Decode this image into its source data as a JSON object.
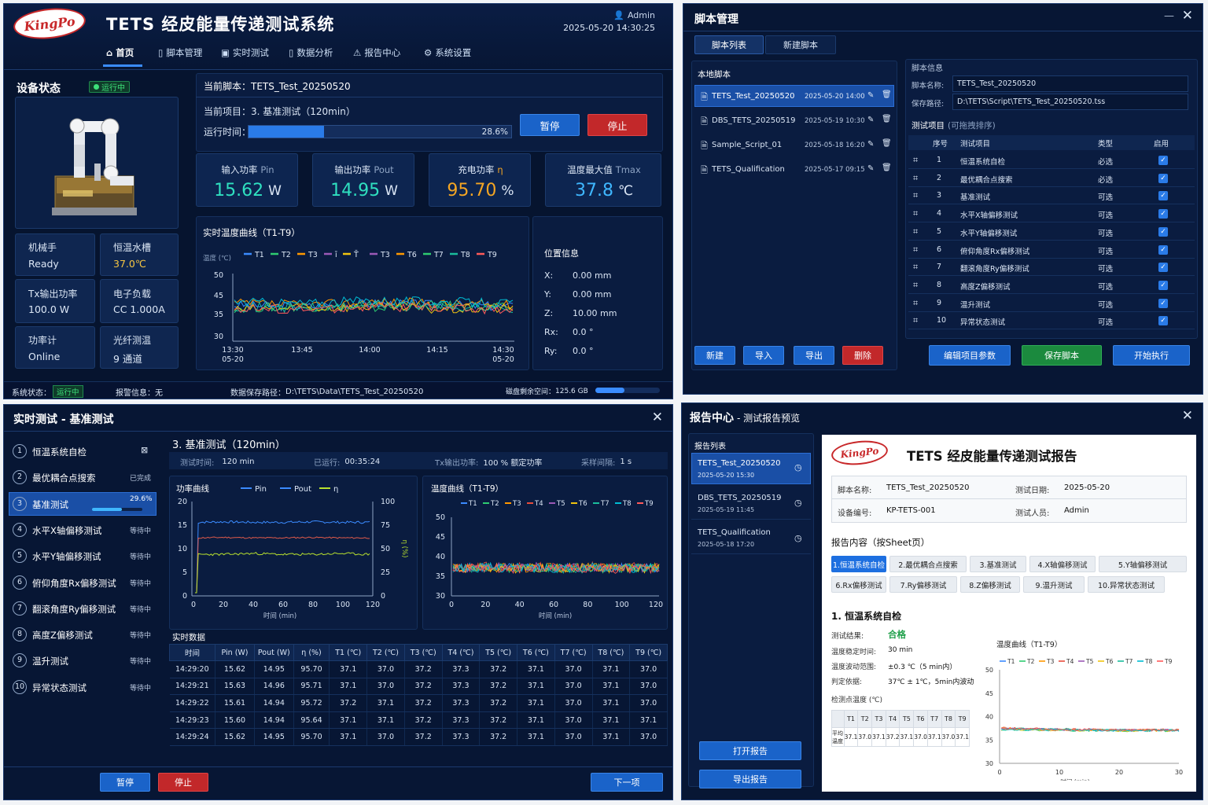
{
  "main": {
    "logo": "KingPo",
    "app_title": "TETS 经皮能量传递测试系统",
    "user": "Admin",
    "datetime": "2025-05-20 14:30:25",
    "nav": [
      {
        "label": "首页",
        "icon": "home-icon"
      },
      {
        "label": "脚本管理",
        "icon": "script-icon"
      },
      {
        "label": "实时测试",
        "icon": "monitor-icon"
      },
      {
        "label": "数据分析",
        "icon": "analysis-icon"
      },
      {
        "label": "报告中心",
        "icon": "report-icon"
      },
      {
        "label": "系统设置",
        "icon": "gear-icon"
      }
    ],
    "device_status_title": "设备状态",
    "device_running_badge": "运行中",
    "device_cells": [
      {
        "label": "机械手",
        "value": "Ready"
      },
      {
        "label": "恒温水槽",
        "value": "37.0℃"
      },
      {
        "label": "Tx输出功率",
        "value": "100.0 W"
      },
      {
        "label": "电子负载",
        "value": "CC 1.000A"
      },
      {
        "label": "功率计",
        "value": "Online"
      },
      {
        "label": "光纤测温",
        "value": "9 通道"
      }
    ],
    "current_script_label": "当前脚本：",
    "current_script": "TETS_Test_20250520",
    "current_item_label": "当前项目：",
    "current_item": "3. 基准测试（120min）",
    "run_time_label": "运行时间：",
    "progress_pct": "28.6%",
    "progress_value": 0.286,
    "pause_label": "暂停",
    "stop_label": "停止",
    "metrics": [
      {
        "label": "输入功率",
        "sym": "Pin",
        "value": "15.62",
        "unit": "W",
        "color": "#2fe0c0"
      },
      {
        "label": "输出功率",
        "sym": "Pout",
        "value": "14.95",
        "unit": "W",
        "color": "#2fe0c0"
      },
      {
        "label": "充电功率",
        "sym": "η",
        "value": "95.70",
        "unit": "%",
        "color": "#f5a623"
      },
      {
        "label": "温度最大值",
        "sym": "Tmax",
        "value": "37.8",
        "unit": "℃",
        "color": "#3fb7ff"
      }
    ],
    "temp_chart_title": "实时温度曲线（T1-T9）",
    "temp_unit": "温度 (℃)",
    "temp_legend": [
      "T1",
      "T2",
      "T3",
      "T4",
      "T5",
      "T6",
      "T7",
      "T8",
      "T9"
    ],
    "temp_legend_shown": [
      "T1",
      "T2",
      "T3",
      "ī",
      "T̄",
      "T3",
      "T6",
      "T7",
      "T8",
      "T9"
    ],
    "temp_y_ticks": [
      "50",
      "45",
      "35",
      "30"
    ],
    "temp_x_ticks": [
      [
        "13:30",
        "05-20"
      ],
      [
        "13:45",
        ""
      ],
      [
        "14:00",
        ""
      ],
      [
        "14:15",
        ""
      ],
      [
        "14:30",
        "05-20"
      ]
    ],
    "pos_title": "位置信息",
    "pos": [
      {
        "k": "X:",
        "v": "0.00 mm"
      },
      {
        "k": "Y:",
        "v": "0.00 mm"
      },
      {
        "k": "Z:",
        "v": "10.00 mm"
      },
      {
        "k": "Rx:",
        "v": "0.0 °"
      },
      {
        "k": "Ry:",
        "v": "0.0 °"
      }
    ],
    "status_bar": {
      "sys_label": "系统状态：",
      "sys_value": "运行中",
      "alarm_label": "报警信息：",
      "alarm_value": "无",
      "path_label": "数据保存路径：",
      "path_value": "D:\\TETS\\Data\\TETS_Test_20250520",
      "disk_label": "磁盘剩余空间：",
      "disk_value": "125.6 GB",
      "disk_fill": 0.45
    }
  },
  "script_mgr": {
    "title": "脚本管理",
    "tabs": [
      "脚本列表",
      "新建脚本"
    ],
    "local_title": "本地脚本",
    "scripts": [
      {
        "name": "TETS_Test_20250520",
        "date": "2025-05-20 14:00",
        "active": true
      },
      {
        "name": "DBS_TETS_20250519",
        "date": "2025-05-19 10:30",
        "active": false
      },
      {
        "name": "Sample_Script_01",
        "date": "2025-05-18 16:20",
        "active": false
      },
      {
        "name": "TETS_Qualification",
        "date": "2025-05-17 09:15",
        "active": false
      }
    ],
    "info_title": "脚本信息",
    "name_label": "脚本名称:",
    "name_value": "TETS_Test_20250520",
    "path_label": "保存路径:",
    "path_value": "D:\\TETS\\Script\\TETS_Test_20250520.tss",
    "items_title": "测试项目",
    "items_hint": "(可拖拽排序)",
    "cols": [
      "序号",
      "测试项目",
      "类型",
      "启用"
    ],
    "items": [
      {
        "no": "1",
        "name": "恒温系统自检",
        "type": "必选"
      },
      {
        "no": "2",
        "name": "最优耦合点搜索",
        "type": "必选"
      },
      {
        "no": "3",
        "name": "基准测试",
        "type": "可选"
      },
      {
        "no": "4",
        "name": "水平X轴偏移测试",
        "type": "可选"
      },
      {
        "no": "5",
        "name": "水平Y轴偏移测试",
        "type": "可选"
      },
      {
        "no": "6",
        "name": "俯仰角度Rx偏移测试",
        "type": "可选"
      },
      {
        "no": "7",
        "name": "翻滚角度Ry偏移测试",
        "type": "可选"
      },
      {
        "no": "8",
        "name": "高度Z偏移测试",
        "type": "可选"
      },
      {
        "no": "9",
        "name": "温升测试",
        "type": "可选"
      },
      {
        "no": "10",
        "name": "异常状态测试",
        "type": "可选"
      }
    ],
    "left_buttons": [
      "新建",
      "导入",
      "导出",
      "删除"
    ],
    "right_buttons": [
      "编辑项目参数",
      "保存脚本",
      "开始执行"
    ]
  },
  "realtime": {
    "title": "实时测试 - 基准测试",
    "steps": [
      {
        "no": "1",
        "label": "恒温系统自检",
        "status": ""
      },
      {
        "no": "2",
        "label": "最优耦合点搜索",
        "status": "已完成"
      },
      {
        "no": "3",
        "label": "基准测试",
        "status": "29.6%"
      },
      {
        "no": "4",
        "label": "水平X轴偏移测试",
        "status": "等待中"
      },
      {
        "no": "5",
        "label": "水平Y轴偏移测试",
        "status": "等待中"
      },
      {
        "no": "6",
        "label": "俯仰角度Rx偏移测试",
        "status": "等待中"
      },
      {
        "no": "7",
        "label": "翻滚角度Ry偏移测试",
        "status": "等待中"
      },
      {
        "no": "8",
        "label": "高度Z偏移测试",
        "status": "等待中"
      },
      {
        "no": "9",
        "label": "温升测试",
        "status": "等待中"
      },
      {
        "no": "10",
        "label": "异常状态测试",
        "status": "等待中"
      }
    ],
    "step3_progress": 0.296,
    "header": "3. 基准测试（120min）",
    "meta": [
      {
        "k": "测试时间:",
        "v": "120  min"
      },
      {
        "k": "已运行:",
        "v": "00:35:24"
      },
      {
        "k": "Tx输出功率:",
        "v": "100  % 额定功率"
      },
      {
        "k": "采样间隔:",
        "v": "1  s"
      }
    ],
    "power_chart": {
      "title": "功率曲线",
      "legend": [
        "Pin",
        "Pout",
        "η"
      ],
      "y_left": [
        "20",
        "15",
        "10",
        "5",
        "0"
      ],
      "y_right": [
        "100",
        "75",
        "50",
        "25",
        "0"
      ],
      "y_right_label": "η (%)",
      "x_ticks": [
        "0",
        "20",
        "40",
        "60",
        "80",
        "100",
        "120"
      ],
      "x_label": "时间 (min)"
    },
    "temp_chart": {
      "title": "温度曲线（T1-T9）",
      "legend": [
        "T1",
        "T2",
        "T3",
        "T4",
        "T5",
        "T6",
        "T7",
        "T8",
        "T9"
      ],
      "y_ticks": [
        "50",
        "45",
        "40",
        "35",
        "30"
      ],
      "x_ticks": [
        "0",
        "20",
        "40",
        "60",
        "80",
        "100",
        "120"
      ],
      "x_label": "时间 (min)"
    },
    "table_title": "实时数据",
    "table_cols": [
      "时间",
      "Pin (W)",
      "Pout (W)",
      "η (%)",
      "T1 (℃)",
      "T2 (℃)",
      "T3 (℃)",
      "T4 (℃)",
      "T5 (℃)",
      "T6 (℃)",
      "T7 (℃)",
      "T8 (℃)",
      "T9 (℃)"
    ],
    "table_rows": [
      [
        "14:29:20",
        "15.62",
        "14.95",
        "95.70",
        "37.1",
        "37.0",
        "37.2",
        "37.3",
        "37.2",
        "37.1",
        "37.0",
        "37.1",
        "37.0"
      ],
      [
        "14:29:21",
        "15.63",
        "14.96",
        "95.71",
        "37.1",
        "37.0",
        "37.2",
        "37.3",
        "37.2",
        "37.1",
        "37.0",
        "37.1",
        "37.0"
      ],
      [
        "14:29:22",
        "15.61",
        "14.94",
        "95.72",
        "37.2",
        "37.1",
        "37.2",
        "37.3",
        "37.2",
        "37.1",
        "37.0",
        "37.1",
        "37.0"
      ],
      [
        "14:29:23",
        "15.60",
        "14.94",
        "95.64",
        "37.1",
        "37.1",
        "37.2",
        "37.3",
        "37.2",
        "37.1",
        "37.0",
        "37.1",
        "37.1"
      ],
      [
        "14:29:24",
        "15.62",
        "14.95",
        "95.70",
        "37.1",
        "37.0",
        "37.2",
        "37.3",
        "37.2",
        "37.1",
        "37.0",
        "37.1",
        "37.0"
      ]
    ],
    "pause_label": "暂停",
    "stop_label": "停止",
    "next_label": "下一项"
  },
  "report": {
    "title": "报告中心",
    "subtitle": "- 测试报告预览",
    "list_title": "报告列表",
    "reports": [
      {
        "name": "TETS_Test_20250520",
        "date": "2025-05-20 15:30",
        "active": true
      },
      {
        "name": "DBS_TETS_20250519",
        "date": "2025-05-19 11:45",
        "active": false
      },
      {
        "name": "TETS_Qualification",
        "date": "2025-05-18 17:20",
        "active": false
      }
    ],
    "open_label": "打开报告",
    "export_label": "导出报告",
    "doc": {
      "logo": "KingPo",
      "title": "TETS 经皮能量传递测试报告",
      "script_label": "脚本名称:",
      "script_value": "TETS_Test_20250520",
      "date_label": "测试日期:",
      "date_value": "2025-05-20",
      "dev_label": "设备编号:",
      "dev_value": "KP-TETS-001",
      "person_label": "测试人员:",
      "person_value": "Admin",
      "content_title": "报告内容（按Sheet页）",
      "sheets": [
        "1.恒温系统自检",
        "2.最优耦合点搜索",
        "3.基准测试",
        "4.X轴偏移测试",
        "5.Y轴偏移测试",
        "6.Rx偏移测试",
        "7.Ry偏移测试",
        "8.Z偏移测试",
        "9.温升测试",
        "10.异常状态测试"
      ],
      "section_title": "1. 恒温系统自检",
      "result_label": "测试结果:",
      "result_value": "合格",
      "stable_label": "温度稳定时间:",
      "stable_value": "30 min",
      "fluct_label": "温度波动范围:",
      "fluct_value": "±0.3 ℃（5 min内）",
      "basis_label": "判定依据:",
      "basis_value": "37℃ ± 1℃，5min内波动",
      "point_label": "检测点温度 (℃)",
      "point_cols": [
        "T1",
        "T2",
        "T3",
        "T4",
        "T5",
        "T6",
        "T7",
        "T8",
        "T9"
      ],
      "point_row_label": "平均温度",
      "point_values": [
        "37.1",
        "37.0",
        "37.1",
        "37.2",
        "37.1",
        "37.0",
        "37.1",
        "37.0",
        "37.1"
      ],
      "chart_title": "温度曲线（T1-T9）",
      "chart_legend": [
        "T1",
        "T2",
        "T3",
        "T4",
        "T5",
        "T6",
        "T7",
        "T8",
        "T9"
      ],
      "chart_y": [
        "50",
        "45",
        "40",
        "35",
        "30"
      ],
      "chart_x": [
        "0",
        "10",
        "20",
        "30"
      ],
      "chart_xlabel": "时间 (min)"
    }
  },
  "series_colors": [
    "#3b8bff",
    "#2ecc71",
    "#ff9800",
    "#e74c3c",
    "#9b59b6",
    "#f1c40f",
    "#1abc9c",
    "#00bcd4",
    "#ff5a5a"
  ],
  "chart_data": [
    {
      "type": "line",
      "title": "实时温度曲线（T1-T9）",
      "ylabel": "温度 (℃)",
      "ylim": [
        30,
        50
      ],
      "x": [
        "13:30",
        "13:45",
        "14:00",
        "14:15",
        "14:30"
      ],
      "series": [
        {
          "name": "T1",
          "values": [
            37.2,
            37.1,
            37.3,
            37.2,
            37.1
          ]
        },
        {
          "name": "T2",
          "values": [
            37.0,
            37.1,
            37.0,
            37.2,
            37.0
          ]
        },
        {
          "name": "T3",
          "values": [
            37.3,
            37.2,
            37.4,
            37.3,
            37.2
          ]
        },
        {
          "name": "T6",
          "values": [
            36.9,
            37.0,
            37.1,
            36.9,
            37.0
          ]
        },
        {
          "name": "T7",
          "values": [
            37.1,
            37.0,
            37.2,
            37.1,
            37.0
          ]
        },
        {
          "name": "T8",
          "values": [
            37.4,
            37.3,
            37.5,
            37.4,
            37.3
          ]
        },
        {
          "name": "T9",
          "values": [
            37.0,
            36.9,
            37.1,
            37.0,
            36.9
          ]
        }
      ]
    },
    {
      "type": "line",
      "title": "功率曲线",
      "xlabel": "时间 (min)",
      "ylim": [
        0,
        20
      ],
      "x": [
        0,
        120
      ],
      "series": [
        {
          "name": "Pin",
          "values": [
            15.6,
            15.7,
            15.6,
            15.6,
            15.7,
            15.6,
            15.6
          ]
        },
        {
          "name": "Pout",
          "values": [
            14.9,
            15.0,
            14.9,
            14.9,
            15.0,
            14.9,
            14.9
          ]
        },
        {
          "name": "η",
          "values": [
            95.7,
            95.7,
            95.6,
            95.7,
            95.8,
            95.7,
            95.7
          ]
        }
      ]
    },
    {
      "type": "line",
      "title": "温度曲线（T1-T9）",
      "xlabel": "时间 (min)",
      "ylim": [
        30,
        50
      ],
      "x": [
        0,
        120
      ],
      "series": [
        {
          "name": "T1",
          "values": [
            37.1,
            37.2,
            37.1,
            37.2,
            37.1,
            37.1,
            37.2
          ]
        },
        {
          "name": "T2",
          "values": [
            37.0,
            37.1,
            37.0,
            37.0,
            37.1,
            37.0,
            37.0
          ]
        },
        {
          "name": "T3",
          "values": [
            37.2,
            37.3,
            37.2,
            37.2,
            37.3,
            37.2,
            37.2
          ]
        },
        {
          "name": "T4",
          "values": [
            37.3,
            37.4,
            37.3,
            37.3,
            37.4,
            37.3,
            37.3
          ]
        },
        {
          "name": "T5",
          "values": [
            37.2,
            37.2,
            37.3,
            37.2,
            37.2,
            37.3,
            37.2
          ]
        },
        {
          "name": "T6",
          "values": [
            37.1,
            37.1,
            37.0,
            37.1,
            37.1,
            37.0,
            37.1
          ]
        },
        {
          "name": "T7",
          "values": [
            37.0,
            37.0,
            37.1,
            37.0,
            37.0,
            37.1,
            37.0
          ]
        },
        {
          "name": "T8",
          "values": [
            37.1,
            37.2,
            37.1,
            37.1,
            37.2,
            37.1,
            37.1
          ]
        },
        {
          "name": "T9",
          "values": [
            37.0,
            37.0,
            36.9,
            37.0,
            37.0,
            36.9,
            37.0
          ]
        }
      ]
    },
    {
      "type": "line",
      "title": "温度曲线（T1-T9）",
      "xlabel": "时间 (min)",
      "ylim": [
        30,
        50
      ],
      "x": [
        0,
        30
      ],
      "series": [
        {
          "name": "T1",
          "values": [
            37.4,
            37.2,
            37.1,
            37.1
          ]
        },
        {
          "name": "T2",
          "values": [
            37.3,
            37.1,
            37.0,
            37.0
          ]
        },
        {
          "name": "T3",
          "values": [
            37.5,
            37.2,
            37.1,
            37.1
          ]
        },
        {
          "name": "T4",
          "values": [
            37.6,
            37.3,
            37.2,
            37.2
          ]
        },
        {
          "name": "T5",
          "values": [
            37.4,
            37.2,
            37.1,
            37.1
          ]
        },
        {
          "name": "T6",
          "values": [
            37.2,
            37.1,
            37.0,
            37.0
          ]
        },
        {
          "name": "T7",
          "values": [
            37.4,
            37.2,
            37.1,
            37.1
          ]
        },
        {
          "name": "T8",
          "values": [
            37.3,
            37.1,
            37.0,
            37.0
          ]
        },
        {
          "name": "T9",
          "values": [
            37.5,
            37.2,
            37.1,
            37.1
          ]
        }
      ]
    }
  ]
}
